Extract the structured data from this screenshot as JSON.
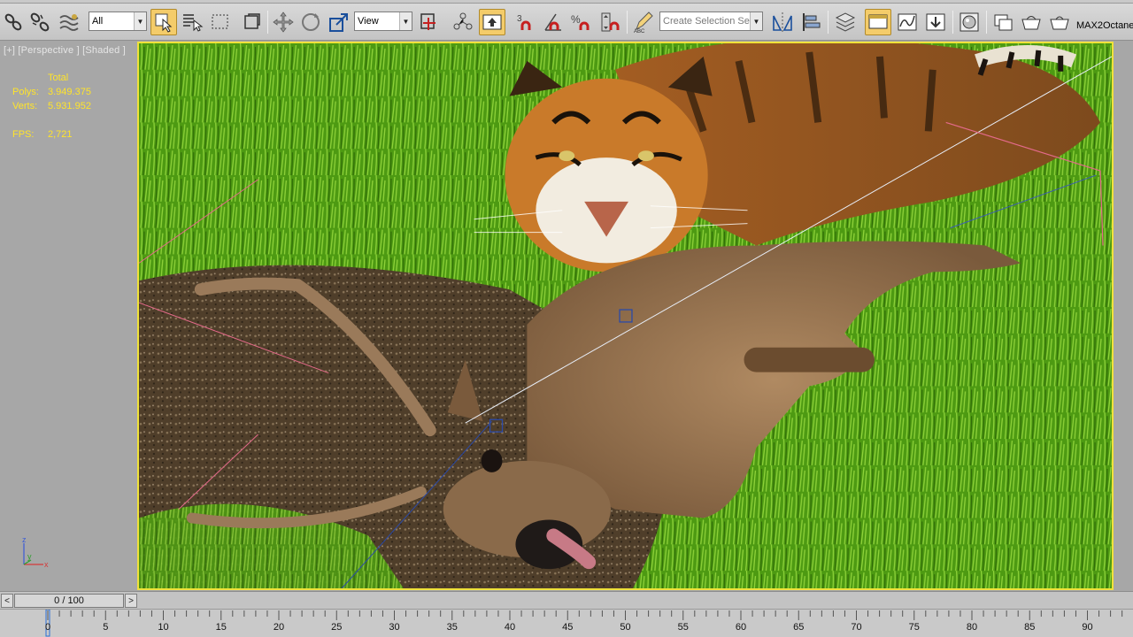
{
  "toolbar": {
    "selection_filter": "All",
    "reference_coord": "View",
    "named_selection_placeholder": "Create Selection Se",
    "plugin_label": "MAX2Octane"
  },
  "viewport": {
    "label": "[+] [Perspective ] [Shaded ]",
    "stats_header": "Total",
    "polys_label": "Polys:",
    "polys_value": "3.949.375",
    "verts_label": "Verts:",
    "verts_value": "5.931.952",
    "fps_label": "FPS:",
    "fps_value": "2,721",
    "axis_labels": {
      "z": "z",
      "y": "y",
      "x": "x"
    }
  },
  "timeline": {
    "prev_label": "<",
    "next_label": ">",
    "frame_display": "0 / 100",
    "current_frame": 0,
    "total_frames": 100
  },
  "trackbar": {
    "tick_labels": [
      "0",
      "5",
      "10",
      "15",
      "20",
      "25",
      "30",
      "35",
      "40",
      "45",
      "50",
      "55",
      "60",
      "65",
      "70",
      "75",
      "80",
      "85",
      "90"
    ]
  },
  "colors": {
    "active_button": "#f4cc6a",
    "viewport_border": "#f0e23a",
    "stats_text": "#ffe42a"
  },
  "icons": [
    "link-icon",
    "unlink-icon",
    "bind-space-warp-icon",
    "select-object-icon",
    "select-by-name-icon",
    "rect-selection-icon",
    "window-crossing-icon",
    "move-icon",
    "rotate-icon",
    "scale-icon",
    "use-pivot-icon",
    "select-manipulate-icon",
    "keyboard-shortcut-icon",
    "snap-3d-icon",
    "angle-snap-icon",
    "percent-snap-icon",
    "spinner-snap-icon",
    "edit-named-selection-icon",
    "mirror-icon",
    "align-icon",
    "layer-manager-icon",
    "graphite-ribbon-icon",
    "curve-editor-icon",
    "schematic-view-icon",
    "material-editor-icon",
    "render-setup-icon",
    "rendered-frame-icon",
    "render-icon"
  ]
}
